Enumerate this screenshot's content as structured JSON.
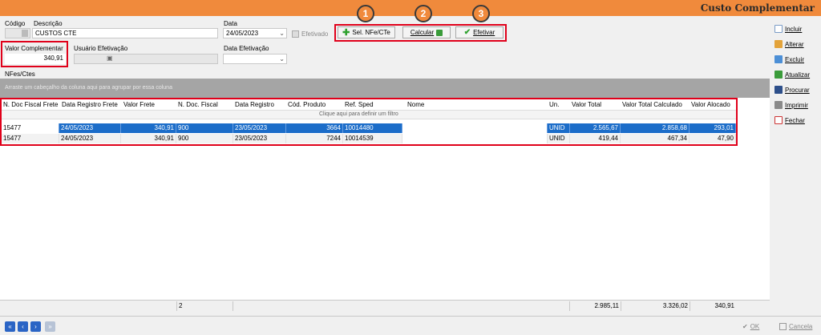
{
  "window": {
    "title": "Custo Complementar"
  },
  "form": {
    "codigo_label": "Código",
    "descricao_label": "Descrição",
    "descricao_value": "CUSTOS CTE",
    "data_label": "Data",
    "data_value": "24/05/2023",
    "efetivado_label": "Efetivado",
    "valor_complementar_label": "Valor Complementar",
    "valor_complementar_value": "340,91",
    "usuario_efetivacao_label": "Usuário Efetivação",
    "data_efetivacao_label": "Data Efetivação"
  },
  "actions": {
    "sel_nfe_label": "Sel. NFe/CTe",
    "calcular_label": "Calcular",
    "efetivar_label": "Efetivar",
    "markers": [
      "1",
      "2",
      "3"
    ]
  },
  "section_label": "NFes/Ctes",
  "group_hint": "Arraste um cabeçalho da coluna aqui para agrupar por essa coluna",
  "filter_hint": "Clique aqui para definir um filtro",
  "grid": {
    "columns": [
      "N. Doc Fiscal Frete",
      "Data Registro Frete",
      "Valor Frete",
      "N. Doc. Fiscal",
      "Data Registro",
      "Cód. Produto",
      "Ref. Sped",
      "Nome",
      "Un.",
      "Valor Total",
      "Valor Total Calculado",
      "Valor Alocado"
    ],
    "rows": [
      [
        "15477",
        "24/05/2023",
        "340,91",
        "900",
        "23/05/2023",
        "3664",
        "10014480",
        "",
        "UNID",
        "2.565,67",
        "2.858,68",
        "293,01"
      ],
      [
        "15477",
        "24/05/2023",
        "340,91",
        "900",
        "23/05/2023",
        "7244",
        "10014539",
        "",
        "UNID",
        "419,44",
        "467,34",
        "47,90"
      ]
    ],
    "footer": {
      "count": "2",
      "valor_total": "2.985,11",
      "valor_total_calculado": "3.326,02",
      "valor_alocado": "340,91"
    }
  },
  "sidebar": {
    "items": [
      {
        "label": "Incluir",
        "icon": "document-icon"
      },
      {
        "label": "Alterar",
        "icon": "pencil-icon"
      },
      {
        "label": "Excluir",
        "icon": "delete-icon"
      },
      {
        "label": "Atualizar",
        "icon": "refresh-icon"
      },
      {
        "label": "Procurar",
        "icon": "binoculars-icon"
      },
      {
        "label": "Imprimir",
        "icon": "printer-icon"
      },
      {
        "label": "Fechar",
        "icon": "close-window-icon"
      }
    ]
  },
  "bottom": {
    "ok_label": "OK",
    "cancel_label": "Cancela"
  },
  "colors": {
    "accent": "#f08a3c",
    "highlight": "#e0001a",
    "selection": "#1c6dc9"
  }
}
